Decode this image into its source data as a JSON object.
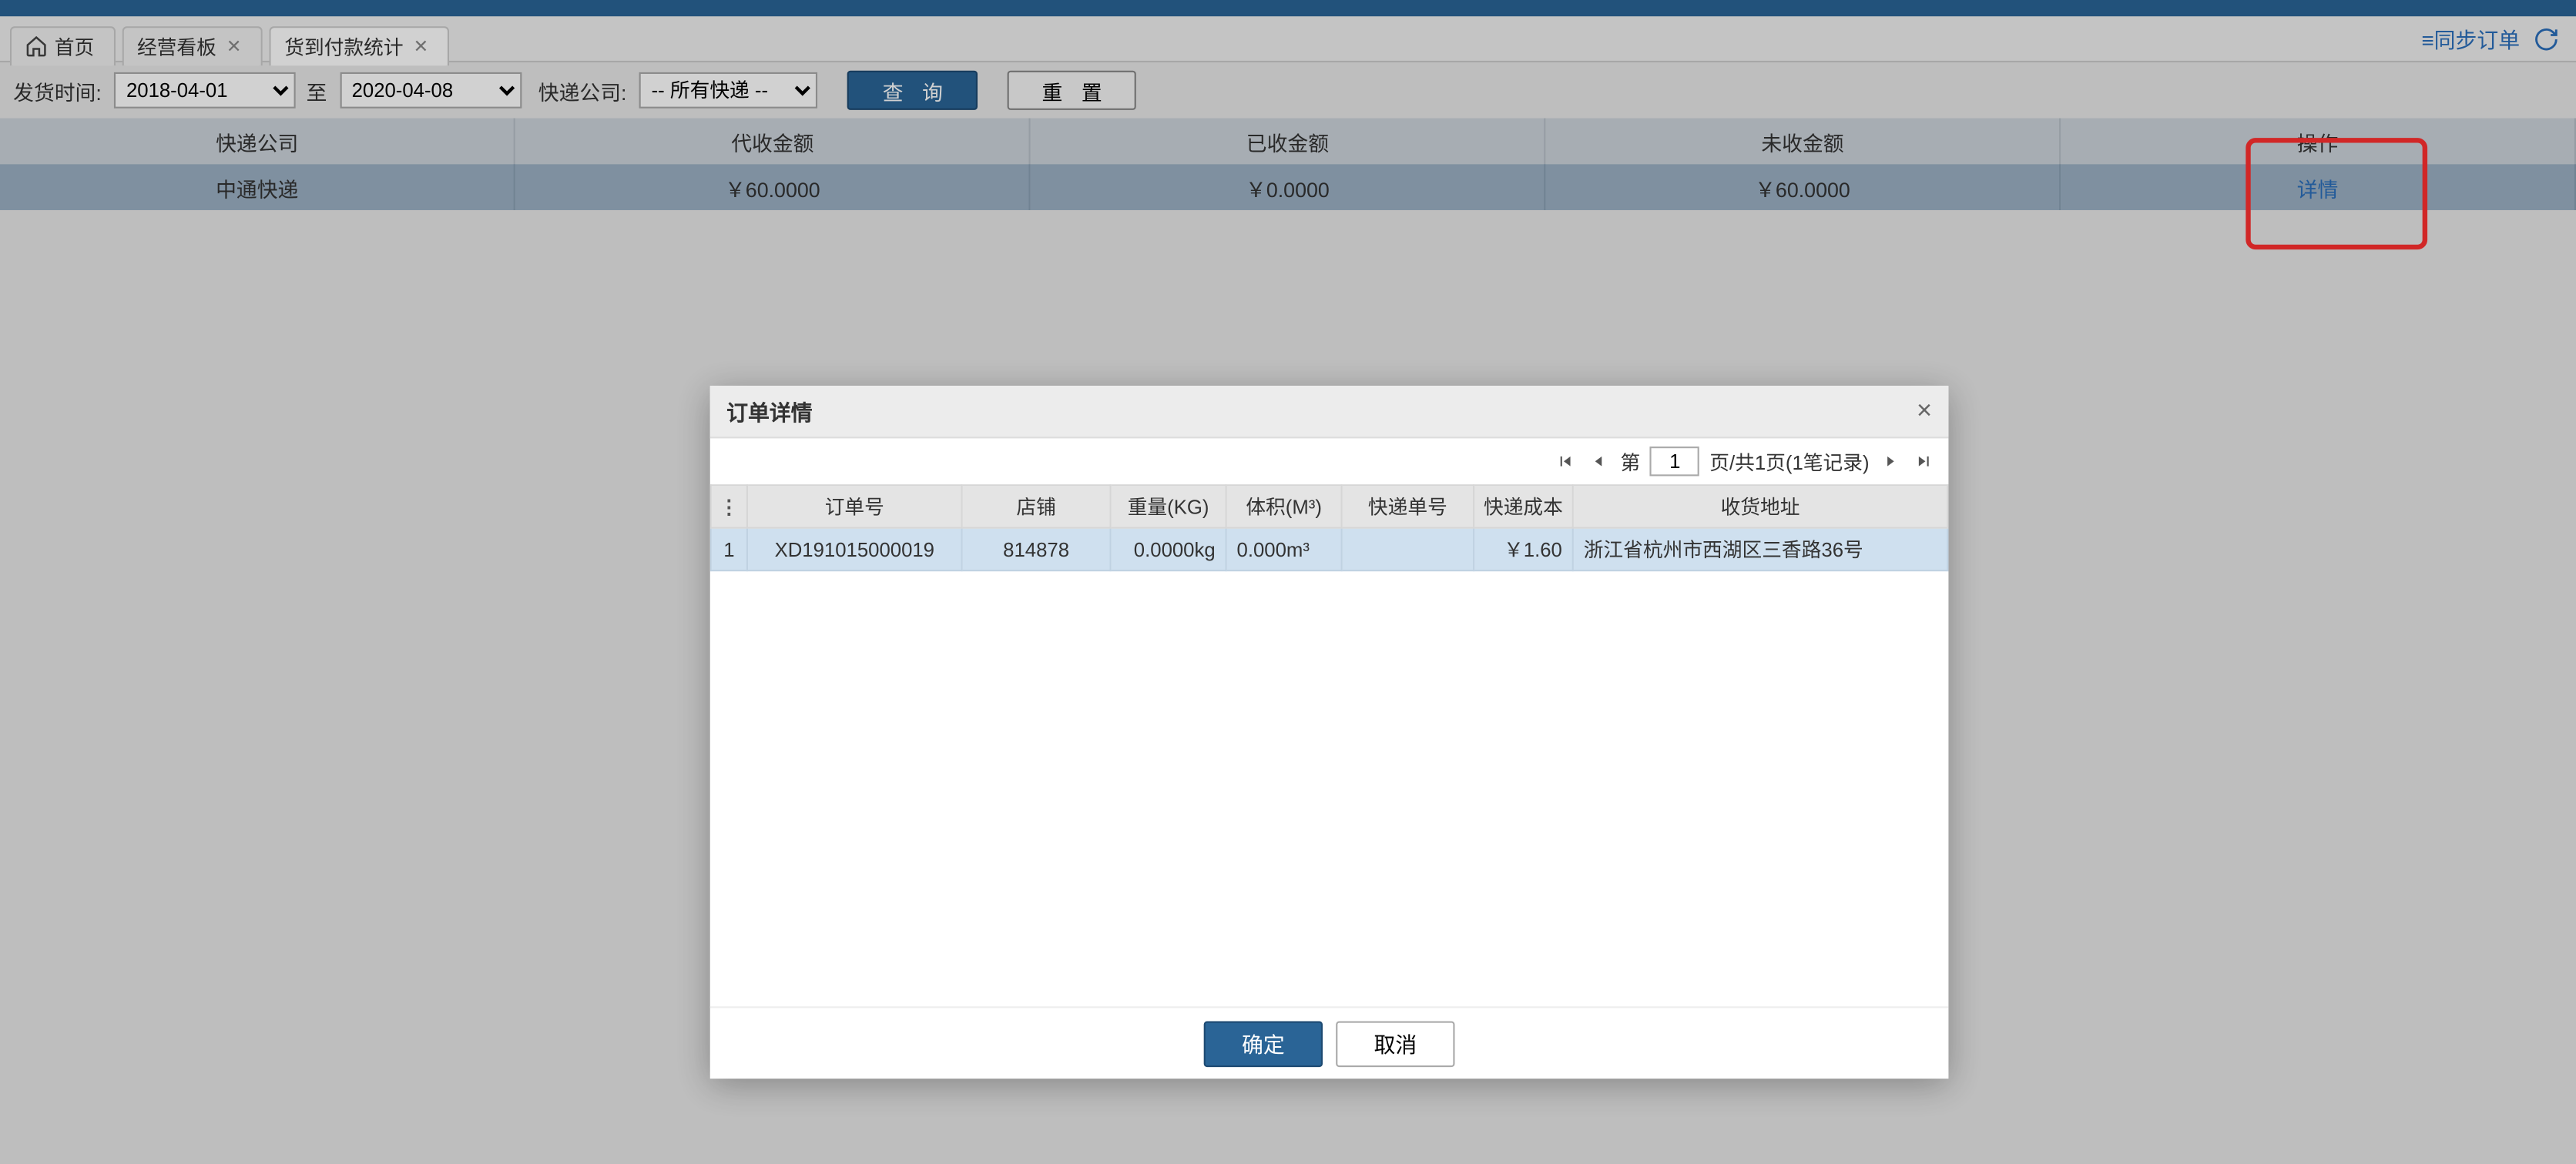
{
  "tabs": {
    "home": "首页",
    "t1": "经营看板",
    "t2": "货到付款统计"
  },
  "sync_label": "≡同步订单",
  "filter": {
    "ship_time_label": "发货时间:",
    "from": "2018-04-01",
    "to_label": "至",
    "to": "2020-04-08",
    "courier_label": "快递公司:",
    "courier_value": "-- 所有快递 --",
    "query": "查 询",
    "reset": "重 置"
  },
  "main_headers": [
    "快递公司",
    "代收金额",
    "已收金额",
    "未收金额",
    "操作"
  ],
  "main_row": {
    "courier": "中通快递",
    "agent_amt": "￥60.0000",
    "recv_amt": "￥0.0000",
    "unrecv_amt": "￥60.0000",
    "action": "详情"
  },
  "modal": {
    "title": "订单详情",
    "pager_pre": "第",
    "pager_page": "1",
    "pager_post": "页/共1页(1笔记录)",
    "headers": {
      "menu": "⋮",
      "order_no": "订单号",
      "shop": "店铺",
      "weight": "重量(KG)",
      "volume": "体积(M³)",
      "express_no": "快递单号",
      "express_cost": "快递成本",
      "address": "收货地址"
    },
    "row": {
      "idx": "1",
      "order_no": "XD191015000019",
      "shop": "814878",
      "weight": "0.0000kg",
      "volume": "0.000m³",
      "express_no": "",
      "express_cost": "￥1.60",
      "address": "浙江省杭州市西湖区三香路36号"
    },
    "ok": "确定",
    "cancel": "取消"
  }
}
